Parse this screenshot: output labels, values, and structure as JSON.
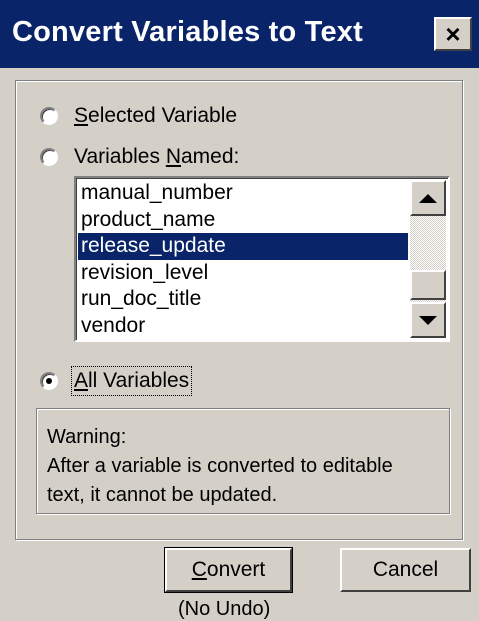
{
  "window": {
    "title": "Convert Variables to Text",
    "close_label": "×"
  },
  "options": {
    "selected_variable": {
      "accesskey": "S",
      "rest": "elected Variable",
      "checked": false
    },
    "variables_named": {
      "prefix": "Variables ",
      "accesskey": "N",
      "rest": "amed:",
      "checked": false
    },
    "all_variables": {
      "accesskey": "A",
      "rest": "ll Variables",
      "checked": true
    }
  },
  "variable_list": {
    "items": [
      "manual_number",
      "product_name",
      "release_update",
      "revision_level",
      "run_doc_title",
      "vendor"
    ],
    "selected_index": 2
  },
  "warning": {
    "line1": "Warning:",
    "line2": "After a variable is converted to editable",
    "line3": "text, it cannot be updated."
  },
  "buttons": {
    "convert": {
      "accesskey": "C",
      "rest": "onvert"
    },
    "cancel": "Cancel"
  },
  "footer_note": "(No Undo)",
  "colors": {
    "titlebar": "#0a246a",
    "face": "#d4d0c8",
    "selection": "#0a246a"
  }
}
